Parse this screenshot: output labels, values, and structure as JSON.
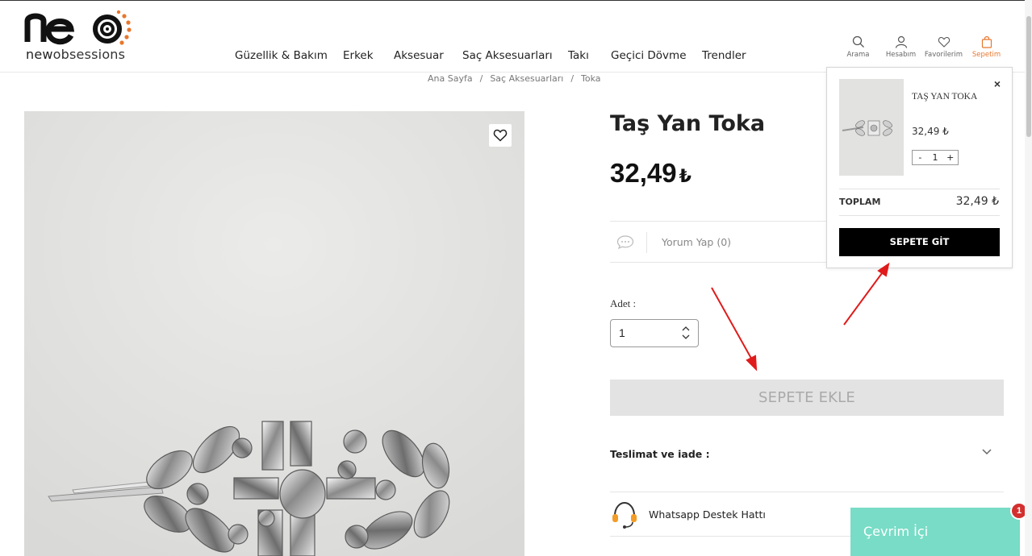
{
  "brand": {
    "logo_main": "neo",
    "logo_sub": "newobsessions",
    "accent_color": "#e8772e"
  },
  "nav": {
    "items": [
      "Güzellik & Bakım",
      "Erkek",
      "Aksesuar",
      "Saç Aksesuarları",
      "Takı",
      "Geçici Dövme",
      "Trendler"
    ]
  },
  "header_icons": {
    "search": {
      "label": "Arama",
      "icon": "search-icon"
    },
    "account": {
      "label": "Hesabım",
      "icon": "user-icon"
    },
    "favorites": {
      "label": "Favorilerim",
      "icon": "heart-icon"
    },
    "cart": {
      "label": "Sepetim",
      "icon": "bag-icon"
    }
  },
  "breadcrumb": {
    "items": [
      "Ana Sayfa",
      "Saç Aksesuarları",
      "Toka"
    ],
    "separator": "/"
  },
  "product": {
    "title": "Taş Yan Toka",
    "price": "32,49",
    "currency": "₺",
    "review_label": "Yorum Yap (0)",
    "qty_label": "Adet :",
    "qty_value": "1",
    "add_to_cart": "SEPETE EKLE",
    "shipping_label": "Teslimat ve iade :",
    "whatsapp_label": "Whatsapp Destek Hattı"
  },
  "cart_popup": {
    "close": "×",
    "item_name": "TAŞ YAN TOKA",
    "item_price": "32,49 ₺",
    "qty_minus": "-",
    "qty_value": "1",
    "qty_plus": "+",
    "total_label": "TOPLAM",
    "total_value": "32,49 ₺",
    "go_button": "SEPETE GİT"
  },
  "chat": {
    "label": "Çevrim İçi",
    "badge": "1",
    "color": "#78dcc6"
  }
}
